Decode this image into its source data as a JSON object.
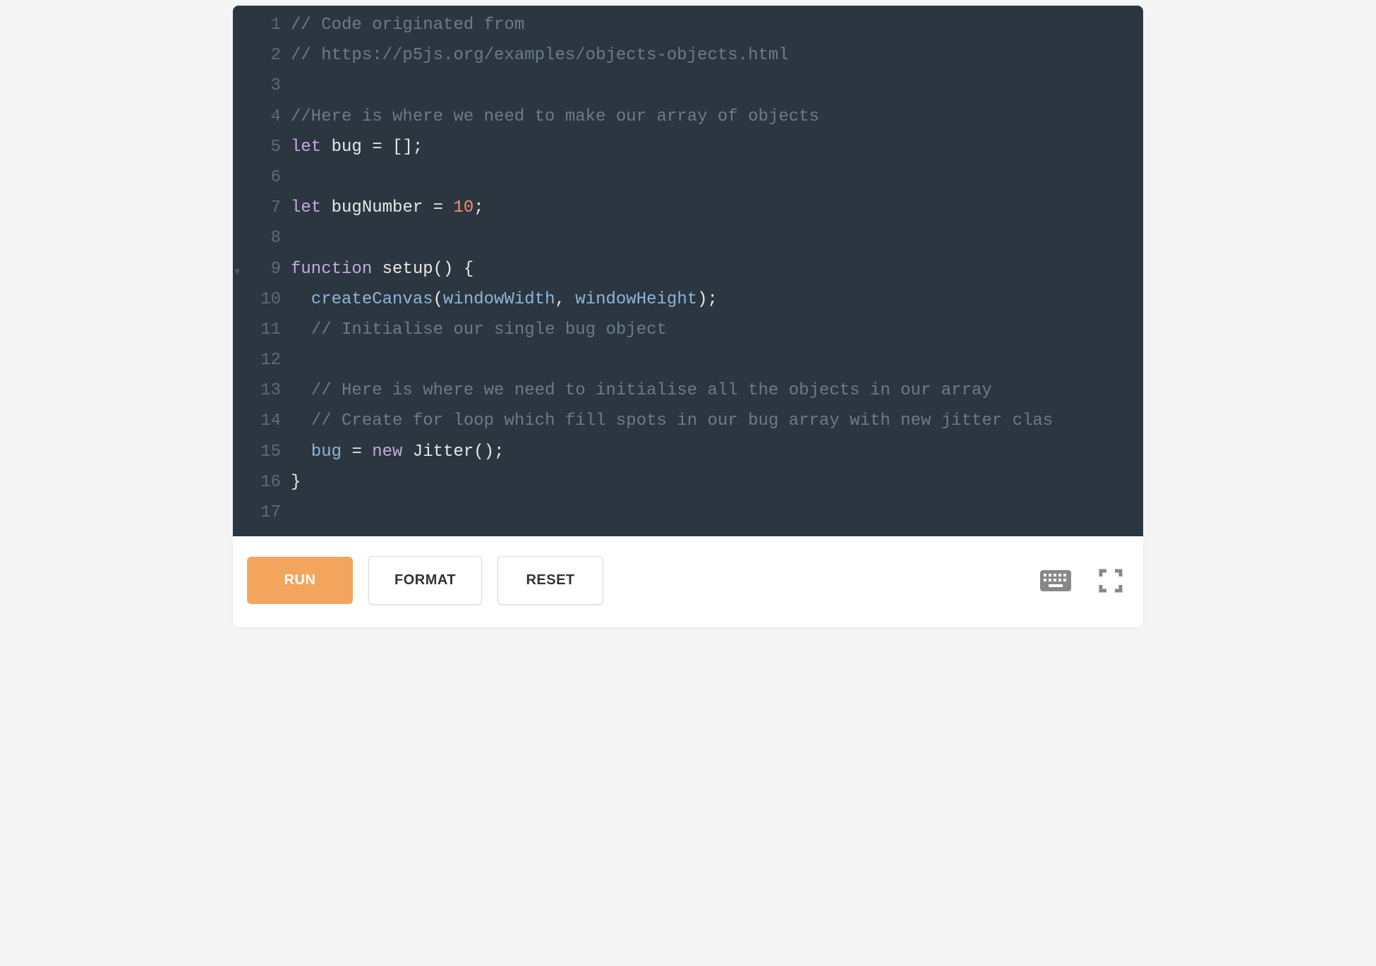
{
  "editor": {
    "theme_bg": "#2b3640",
    "fold_markers": [
      {
        "line": 9,
        "glyph": "▼"
      }
    ],
    "lines": [
      {
        "n": 1,
        "tokens": [
          {
            "t": "// Code originated from",
            "c": "comment"
          }
        ]
      },
      {
        "n": 2,
        "tokens": [
          {
            "t": "// https://p5js.org/examples/objects-objects.html",
            "c": "comment"
          }
        ]
      },
      {
        "n": 3,
        "tokens": [
          {
            "t": "",
            "c": "ident"
          }
        ]
      },
      {
        "n": 4,
        "tokens": [
          {
            "t": "//Here is where we need to make our array of objects",
            "c": "comment"
          }
        ]
      },
      {
        "n": 5,
        "tokens": [
          {
            "t": "let",
            "c": "keyword"
          },
          {
            "t": " bug ",
            "c": "ident"
          },
          {
            "t": "=",
            "c": "punc"
          },
          {
            "t": " ",
            "c": "ident"
          },
          {
            "t": "[];",
            "c": "punc"
          }
        ]
      },
      {
        "n": 6,
        "tokens": [
          {
            "t": "",
            "c": "ident"
          }
        ]
      },
      {
        "n": 7,
        "tokens": [
          {
            "t": "let",
            "c": "keyword"
          },
          {
            "t": " bugNumber ",
            "c": "ident"
          },
          {
            "t": "=",
            "c": "punc"
          },
          {
            "t": " ",
            "c": "ident"
          },
          {
            "t": "10",
            "c": "num"
          },
          {
            "t": ";",
            "c": "punc"
          }
        ]
      },
      {
        "n": 8,
        "tokens": [
          {
            "t": "",
            "c": "ident"
          }
        ]
      },
      {
        "n": 9,
        "tokens": [
          {
            "t": "function",
            "c": "keyword"
          },
          {
            "t": " ",
            "c": "ident"
          },
          {
            "t": "setup",
            "c": "ident"
          },
          {
            "t": "()",
            "c": "punc"
          },
          {
            "t": " ",
            "c": "ident"
          },
          {
            "t": "{",
            "c": "punc"
          }
        ]
      },
      {
        "n": 10,
        "tokens": [
          {
            "t": "  ",
            "c": "ident"
          },
          {
            "t": "createCanvas",
            "c": "func"
          },
          {
            "t": "(",
            "c": "punc"
          },
          {
            "t": "windowWidth",
            "c": "param"
          },
          {
            "t": ",",
            "c": "punc"
          },
          {
            "t": " ",
            "c": "ident"
          },
          {
            "t": "windowHeight",
            "c": "param"
          },
          {
            "t": ");",
            "c": "punc"
          }
        ]
      },
      {
        "n": 11,
        "tokens": [
          {
            "t": "  ",
            "c": "ident"
          },
          {
            "t": "// Initialise our single bug object",
            "c": "comment"
          }
        ]
      },
      {
        "n": 12,
        "tokens": [
          {
            "t": "",
            "c": "ident"
          }
        ]
      },
      {
        "n": 13,
        "tokens": [
          {
            "t": "  ",
            "c": "ident"
          },
          {
            "t": "// Here is where we need to initialise all the objects in our array",
            "c": "comment"
          }
        ]
      },
      {
        "n": 14,
        "tokens": [
          {
            "t": "  ",
            "c": "ident"
          },
          {
            "t": "// Create for loop which fill spots in our bug array with new jitter clas",
            "c": "comment"
          }
        ]
      },
      {
        "n": 15,
        "tokens": [
          {
            "t": "  ",
            "c": "ident"
          },
          {
            "t": "bug",
            "c": "var"
          },
          {
            "t": " ",
            "c": "ident"
          },
          {
            "t": "=",
            "c": "punc"
          },
          {
            "t": " ",
            "c": "ident"
          },
          {
            "t": "new",
            "c": "new"
          },
          {
            "t": " ",
            "c": "ident"
          },
          {
            "t": "Jitter",
            "c": "class"
          },
          {
            "t": "();",
            "c": "punc"
          }
        ]
      },
      {
        "n": 16,
        "tokens": [
          {
            "t": "}",
            "c": "punc"
          }
        ]
      },
      {
        "n": 17,
        "tokens": [
          {
            "t": "",
            "c": "ident"
          }
        ]
      }
    ]
  },
  "toolbar": {
    "run_label": "RUN",
    "format_label": "FORMAT",
    "reset_label": "RESET",
    "keyboard_icon": "keyboard-icon",
    "fullscreen_icon": "fullscreen-icon"
  }
}
